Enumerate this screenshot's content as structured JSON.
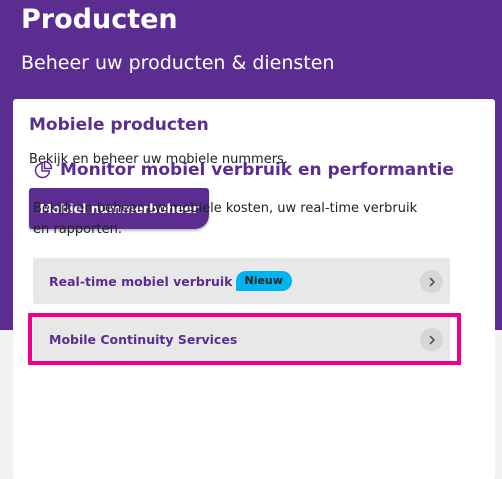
{
  "header": {
    "title": "Producten",
    "subtitle": "Beheer uw producten & diensten"
  },
  "mobile_products": {
    "title": "Mobiele producten",
    "description": "Bekijk en beheer uw mobiele nummers.",
    "button_label": "Mobiel nummerbeheer"
  },
  "monitor": {
    "icon": "pie-chart-icon",
    "title": "Monitor mobiel verbruik en performantie",
    "description": "Bekijk en beheer uw mobiele kosten, uw real-time verbruik en rapporten.",
    "items": [
      {
        "label": "Real-time mobiel verbruik",
        "badge": "Nieuw",
        "icon": "chevron-right-icon"
      },
      {
        "label": "Mobile Continuity Services",
        "icon": "chevron-right-icon",
        "highlighted": true
      }
    ]
  },
  "colors": {
    "brand_purple": "#5c2d91",
    "badge_blue": "#00b4f0",
    "highlight_pink": "#ec008c",
    "item_bg": "#e8e8e8"
  }
}
